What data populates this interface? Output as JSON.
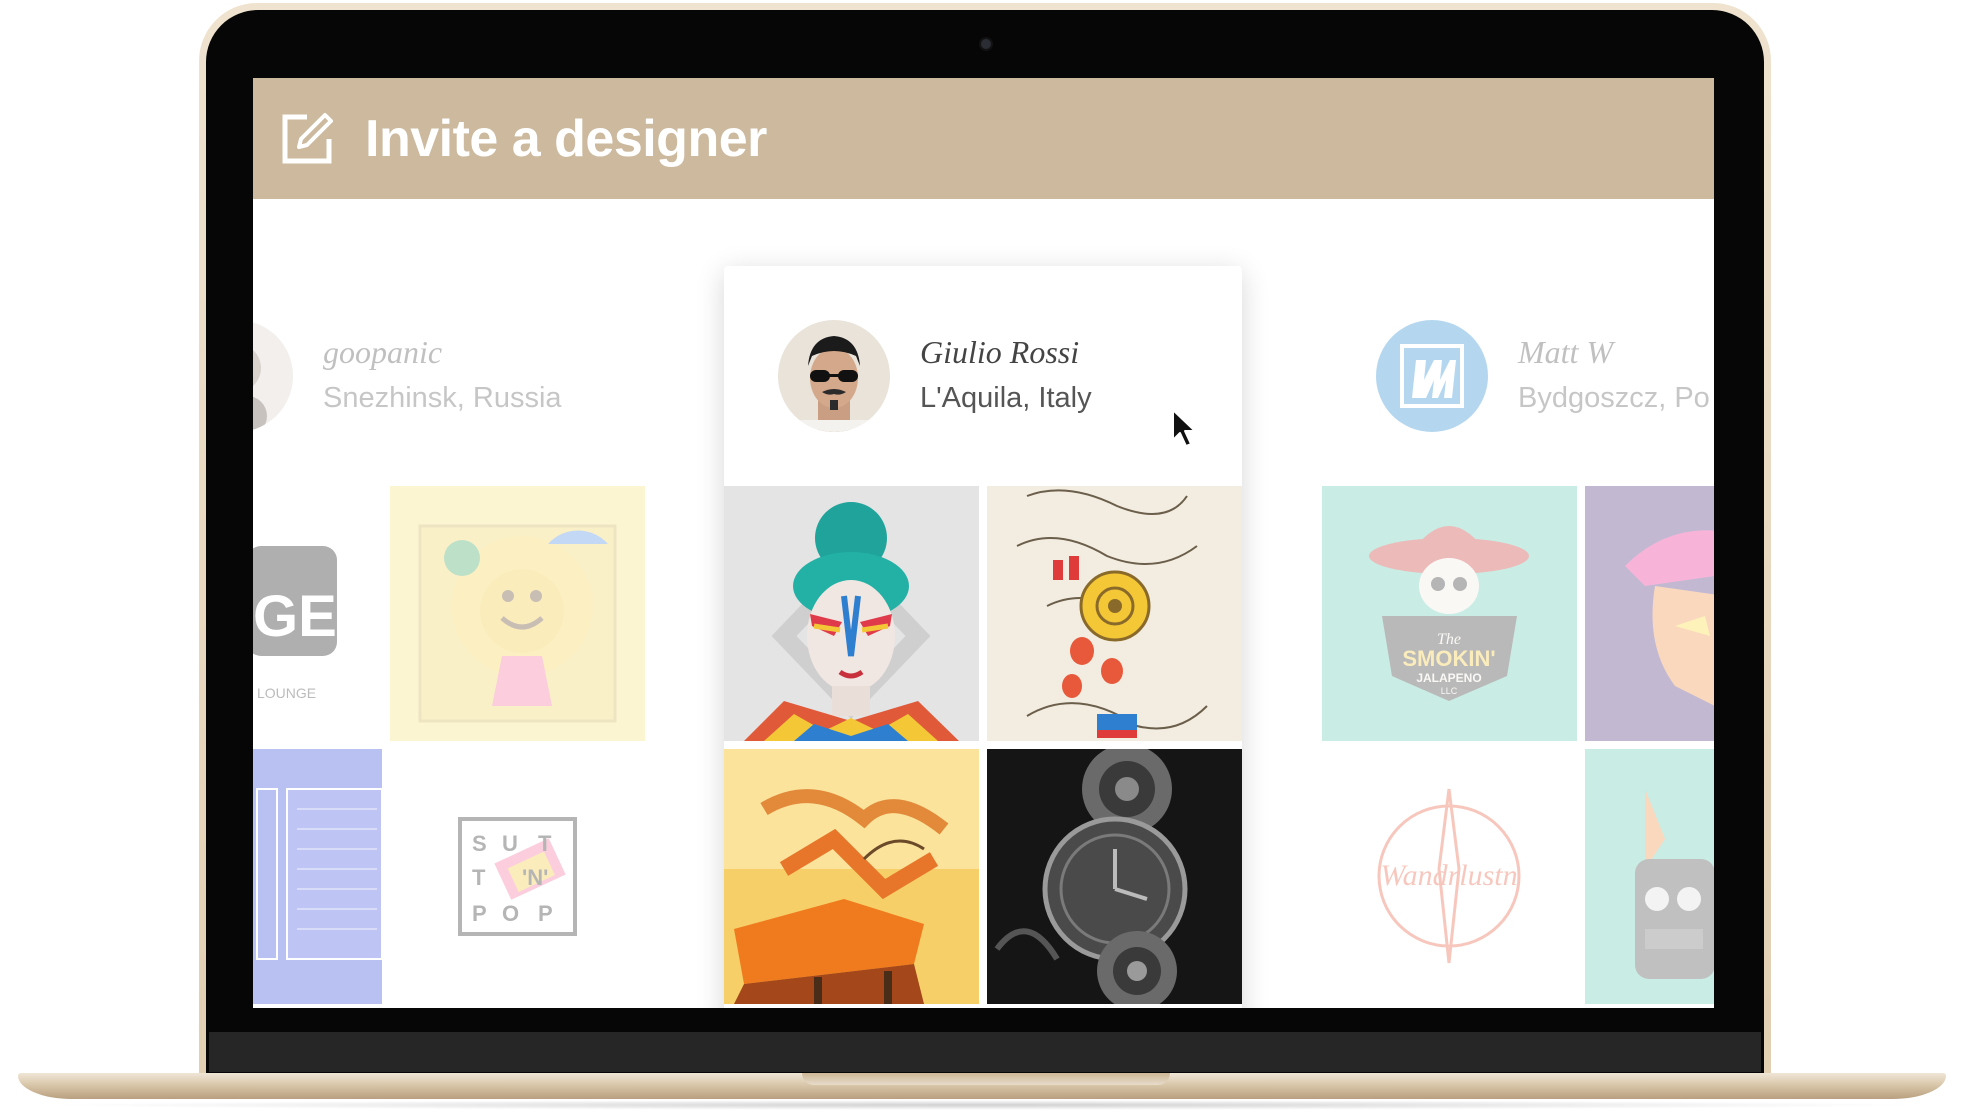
{
  "header": {
    "title": "Invite a designer",
    "icon": "edit-icon",
    "background": "#ccb99e"
  },
  "designers": [
    {
      "name": "goopanic",
      "location": "Snezhinsk, Russia"
    },
    {
      "name": "Giulio Rossi",
      "location": "L'Aquila, Italy"
    },
    {
      "name": "Matt W",
      "location": "Bydgoszcz, Po"
    }
  ],
  "portfolio": {
    "left": {
      "tile1_text": "GEA",
      "tile1_sub": "LOUNGE",
      "tile4_text": [
        "S",
        "U",
        "T",
        "T",
        "'N'",
        "P",
        "O",
        "P"
      ]
    },
    "right": {
      "tile1_text": "SMOKIN'",
      "tile1_brand": "The",
      "tile1_sub": "JALAPENO",
      "tile1_sub2": "LLC",
      "tile3_text": "Wandrlustn"
    }
  }
}
